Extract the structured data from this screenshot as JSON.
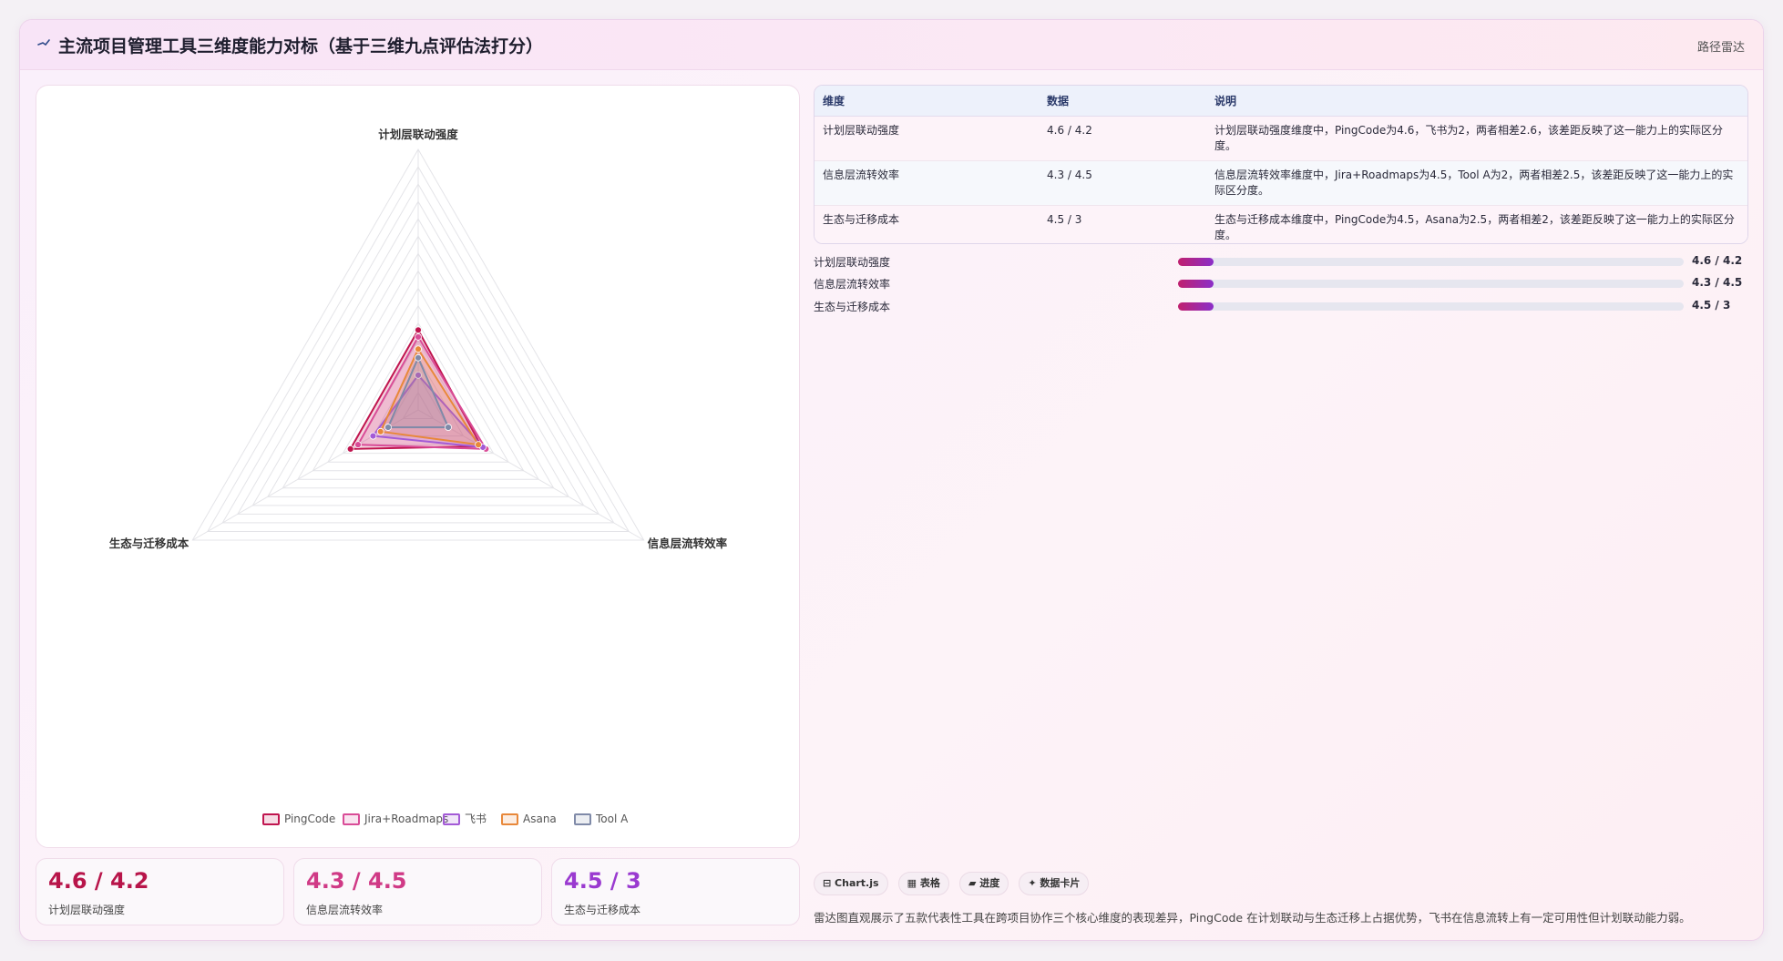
{
  "header": {
    "icon": "radar-line-icon",
    "title": "主流项目管理工具三维度能力对标（基于三维九点评估法打分）",
    "right_label": "路径雷达"
  },
  "colors": {
    "pingcode": "#c0154f",
    "jira": "#d94c97",
    "feishu": "#a35ad6",
    "asana": "#e8883a",
    "toola": "#7f8aa8"
  },
  "chart_data": {
    "type": "radar",
    "axes": [
      "计划层联动强度",
      "信息层流转效率",
      "生态与迁移成本"
    ],
    "rmax": 15,
    "grid_levels": 15,
    "series": [
      {
        "name": "PingCode",
        "values": [
          4.6,
          4.2,
          4.5
        ]
      },
      {
        "name": "Jira+Roadmaps",
        "values": [
          4.2,
          4.5,
          4.0
        ]
      },
      {
        "name": "飞书",
        "values": [
          2.0,
          4.3,
          3.0
        ]
      },
      {
        "name": "Asana",
        "values": [
          3.5,
          4.0,
          2.5
        ]
      },
      {
        "name": "Tool A",
        "values": [
          3.0,
          2.0,
          2.0
        ]
      }
    ],
    "legend": [
      "PingCode",
      "Jira+Roadmaps",
      "飞书",
      "Asana",
      "Tool A"
    ],
    "legend_position": "bottom"
  },
  "table": {
    "headers": [
      "维度",
      "数据",
      "说明"
    ],
    "rows": [
      [
        "计划层联动强度",
        "4.6 / 4.2",
        "计划层联动强度维度中，PingCode为4.6，飞书为2，两者相差2.6，该差距反映了这一能力上的实际区分度。"
      ],
      [
        "信息层流转效率",
        "4.3 / 4.5",
        "信息层流转效率维度中，Jira+Roadmaps为4.5，Tool A为2，两者相差2.5，该差距反映了这一能力上的实际区分度。"
      ],
      [
        "生态与迁移成本",
        "4.5 / 3",
        "生态与迁移成本维度中，PingCode为4.5，Asana为2.5，两者相差2，该差距反映了这一能力上的实际区分度。"
      ]
    ]
  },
  "progress": [
    {
      "label": "计划层联动强度",
      "value": "4.6 / 4.2",
      "fraction": 0.07
    },
    {
      "label": "信息层流转效率",
      "value": "4.3 / 4.5",
      "fraction": 0.07
    },
    {
      "label": "生态与迁移成本",
      "value": "4.5 / 3",
      "fraction": 0.07
    }
  ],
  "stats": [
    {
      "value": "4.6 / 4.2",
      "label": "计划层联动强度",
      "color": "#b8154a"
    },
    {
      "value": "4.3 / 4.5",
      "label": "信息层流转效率",
      "color": "#d03a86"
    },
    {
      "value": "4.5 / 3",
      "label": "生态与迁移成本",
      "color": "#9a3ad0"
    }
  ],
  "tags": [
    "⊟ Chart.js",
    "▦ 表格",
    "▰ 进度",
    "✦ 数据卡片"
  ],
  "footnote": "雷达图直观展示了五款代表性工具在跨项目协作三个核心维度的表现差异，PingCode 在计划联动与生态迁移上占据优势，飞书在信息流转上有一定可用性但计划联动能力弱。"
}
